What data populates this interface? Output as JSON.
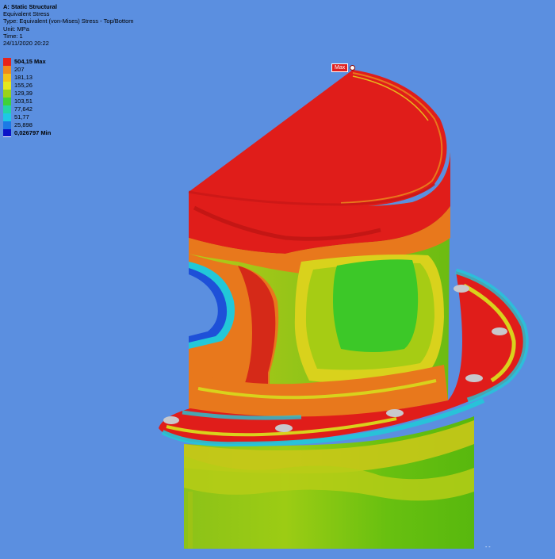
{
  "info": {
    "title": "A: Static Structural",
    "result_name": "Equivalent Stress",
    "type_line": "Type: Equivalent (von-Mises) Stress - Top/Bottom",
    "unit_line": "Unit: MPa",
    "time_line": "Time: 1",
    "date_line": "24/11/2020 20:22"
  },
  "legend": {
    "items": [
      {
        "label": "504,15 Max",
        "color": "#e8221a",
        "bold": true
      },
      {
        "label": "207",
        "color": "#f08a1c",
        "bold": false
      },
      {
        "label": "181,13",
        "color": "#f2c21a",
        "bold": false
      },
      {
        "label": "155,26",
        "color": "#e4e820",
        "bold": false
      },
      {
        "label": "129,39",
        "color": "#9ad21c",
        "bold": false
      },
      {
        "label": "103,51",
        "color": "#3fd23a",
        "bold": false
      },
      {
        "label": "77,642",
        "color": "#22d6a6",
        "bold": false
      },
      {
        "label": "51,77",
        "color": "#1ec8e6",
        "bold": false
      },
      {
        "label": "25,898",
        "color": "#1c7ae6",
        "bold": false
      },
      {
        "label": "0,026797 Min",
        "color": "#0a12c8",
        "bold": true
      }
    ]
  },
  "max_probe": {
    "label": "Max"
  },
  "colors": {
    "background": "#5b8fe0",
    "red": "#e01d1a",
    "dark_red": "#b81412",
    "orange": "#e8781c",
    "yellow": "#d9d21c",
    "yellow_green": "#a6cc14",
    "green": "#5ac814",
    "bright_green": "#36c83a",
    "cyan": "#22c8d8",
    "blue": "#1e50d8",
    "hole_gray": "#c8c8cc"
  }
}
